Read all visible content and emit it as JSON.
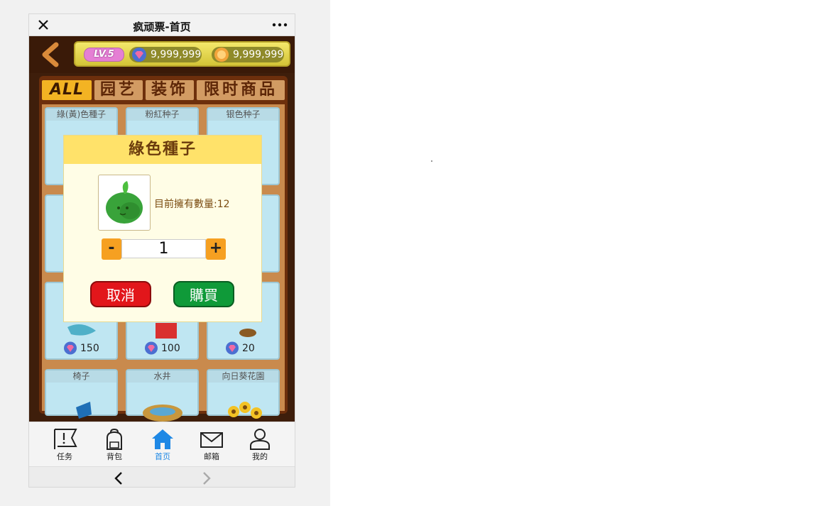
{
  "window": {
    "title": "疯顽票-首页"
  },
  "status": {
    "level": "LV.5",
    "gems": "9,999,999",
    "coins": "9,999,999"
  },
  "tabs": [
    "ALL",
    "园艺",
    "装饰",
    "限时商品"
  ],
  "items": [
    {
      "name": "綠(黃)色種子",
      "price": ""
    },
    {
      "name": "粉紅种子",
      "price": ""
    },
    {
      "name": "银色种子",
      "price": ""
    },
    {
      "name": "",
      "price": "150"
    },
    {
      "name": "",
      "price": "100"
    },
    {
      "name": "",
      "price": "20"
    },
    {
      "name": "椅子",
      "price": ""
    },
    {
      "name": "水井",
      "price": ""
    },
    {
      "name": "向日葵花園",
      "price": ""
    }
  ],
  "modal": {
    "title": "綠色種子",
    "owned_text": "目前擁有數量:12",
    "quantity": "1",
    "minus": "-",
    "plus": "+",
    "cancel": "取消",
    "buy": "購買"
  },
  "nav": [
    {
      "label": "任务",
      "icon": "flag-icon"
    },
    {
      "label": "背包",
      "icon": "backpack-icon"
    },
    {
      "label": "首页",
      "icon": "home-icon",
      "active": true
    },
    {
      "label": "邮箱",
      "icon": "mail-icon"
    },
    {
      "label": "我的",
      "icon": "user-icon"
    }
  ],
  "colors": {
    "accent": "#1e88e5",
    "cancel": "#e2161b",
    "buy": "#0f9a39",
    "stepper": "#f6a021"
  }
}
